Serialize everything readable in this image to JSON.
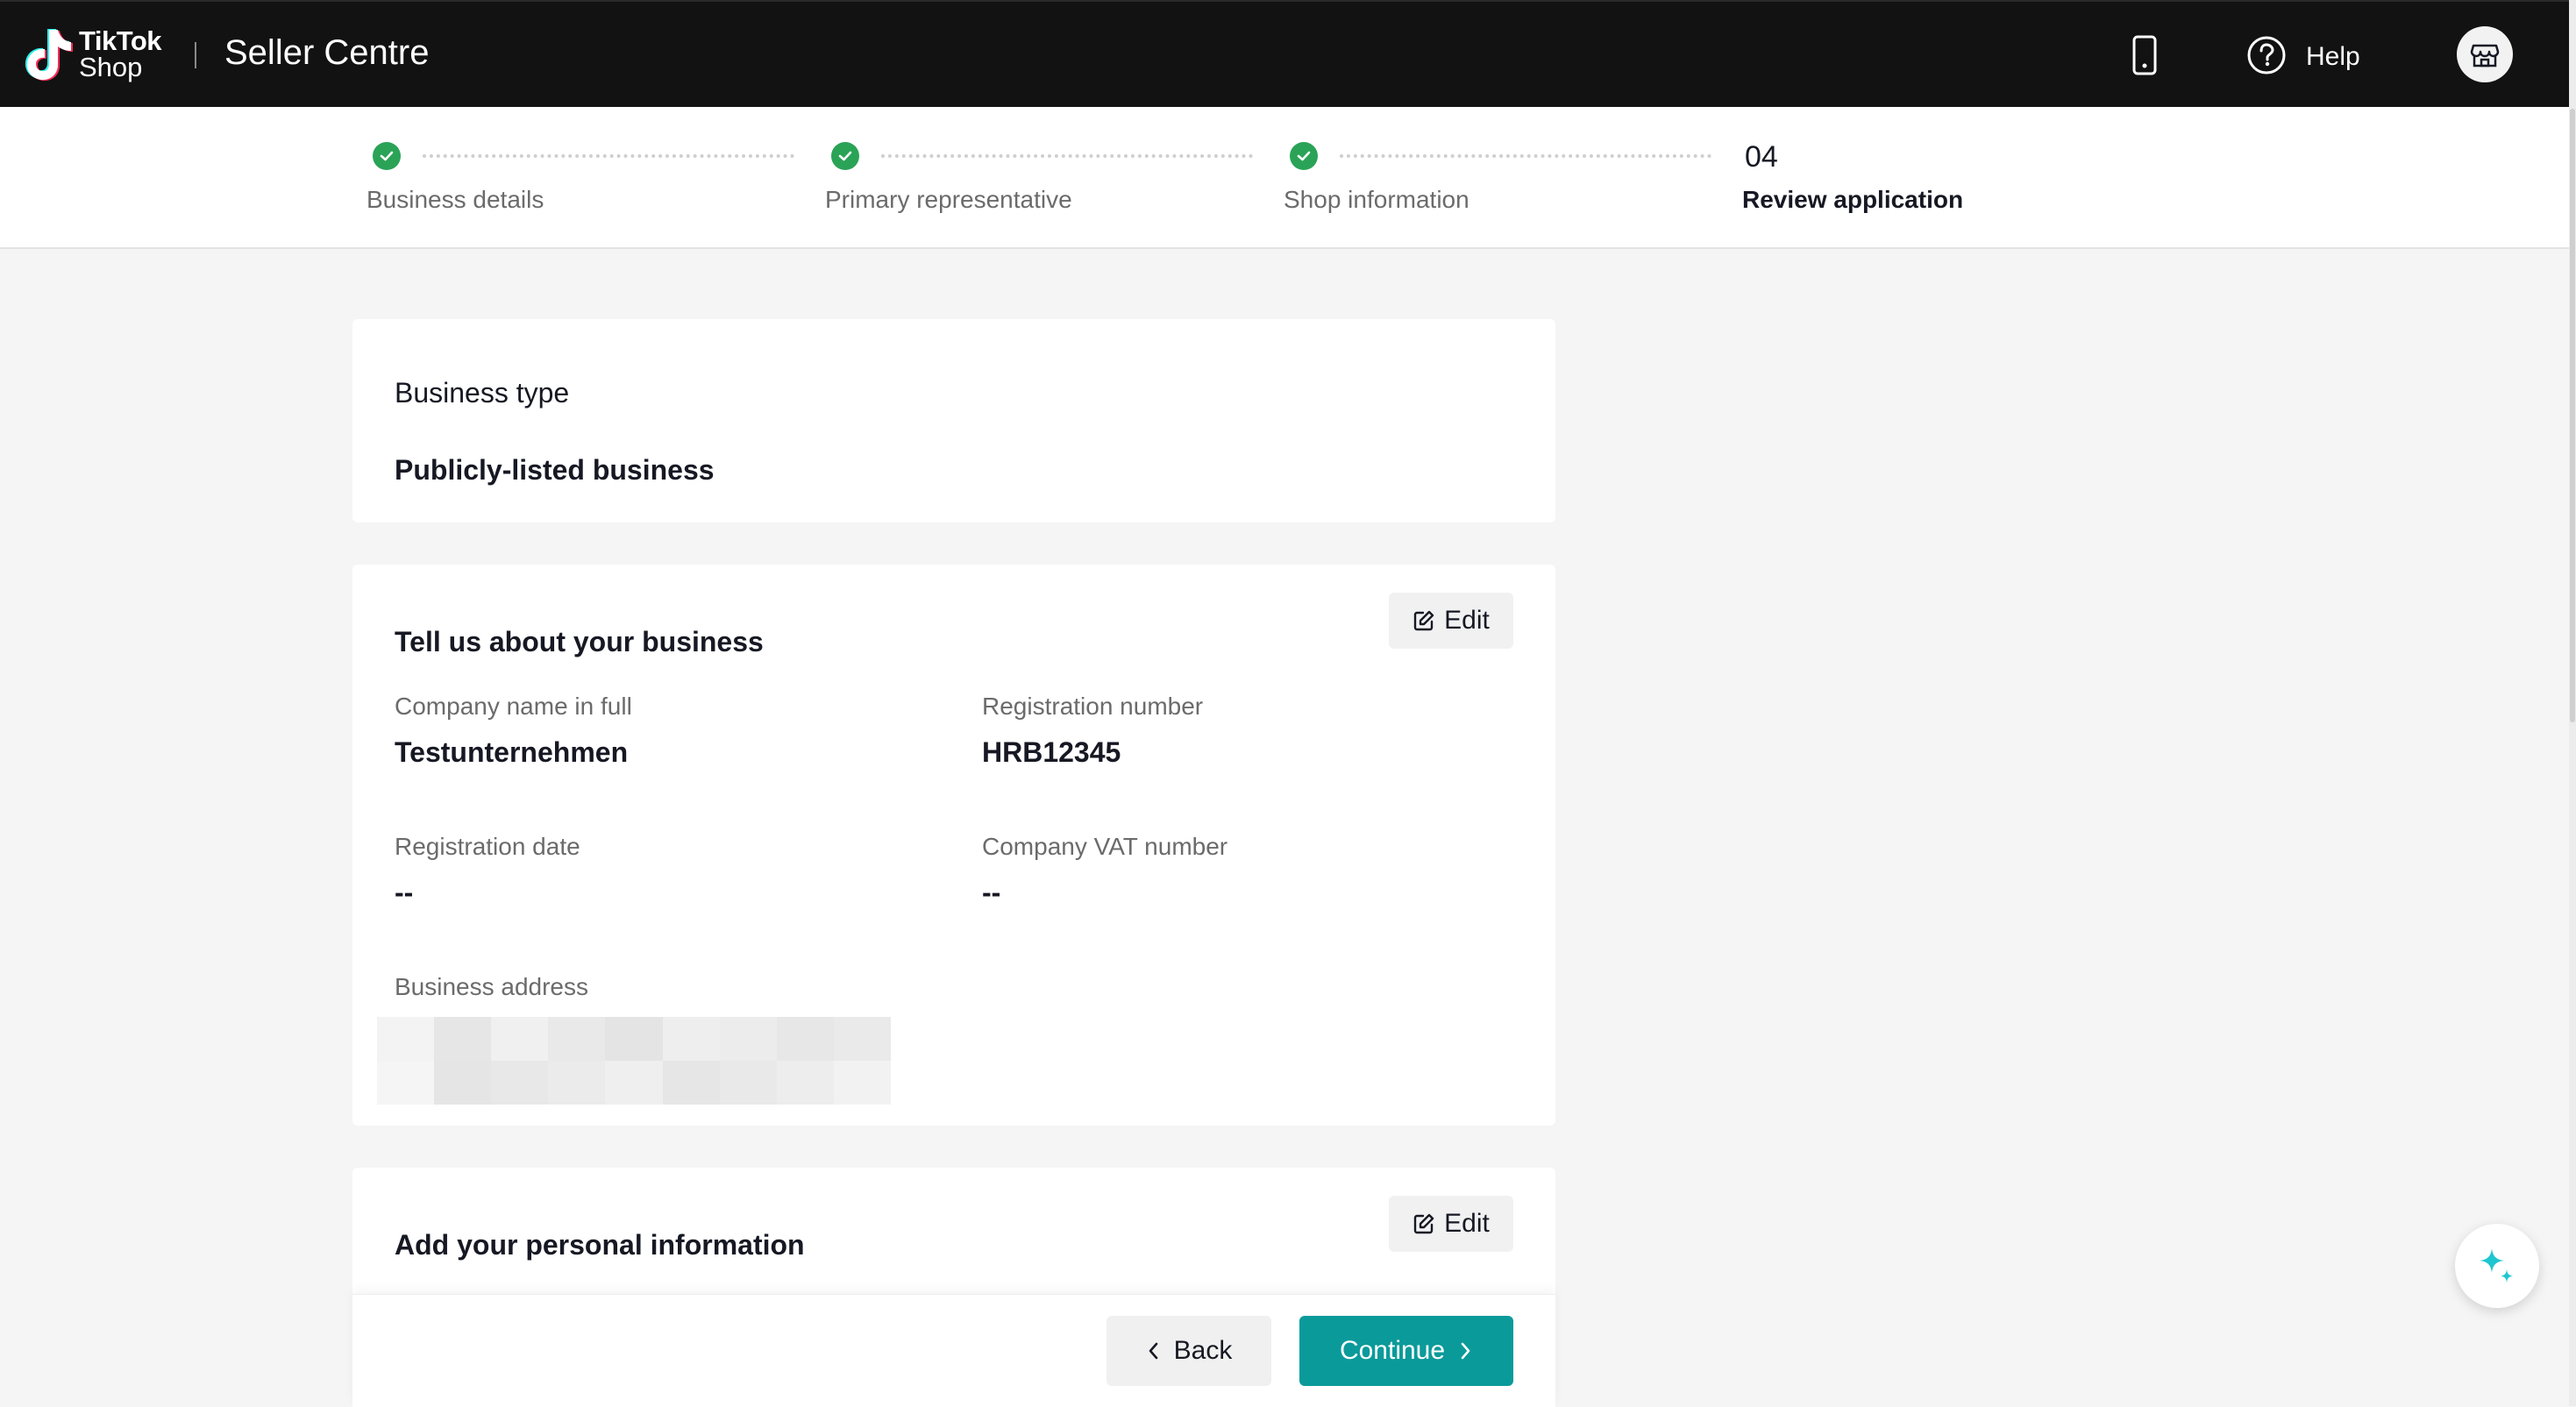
{
  "header": {
    "logo_line1": "TikTok",
    "logo_line2": "Shop",
    "app_title": "Seller Centre",
    "phone_icon": "mobile-phone-icon",
    "help_icon": "question-circle-icon",
    "help_label": "Help",
    "shop_icon": "store-icon"
  },
  "stepper": {
    "steps": [
      {
        "label": "Business details",
        "status": "completed"
      },
      {
        "label": "Primary representative",
        "status": "completed"
      },
      {
        "label": "Shop information",
        "status": "completed"
      },
      {
        "number": "04",
        "label": "Review application",
        "status": "current"
      }
    ],
    "completed_color": "#2aa357"
  },
  "business_type": {
    "title": "Business type",
    "value": "Publicly-listed business"
  },
  "business_info": {
    "title": "Tell us about your business",
    "edit_label": "Edit",
    "company_name_label": "Company name in full",
    "company_name_value": "Testunternehmen",
    "registration_number_label": "Registration number",
    "registration_number_value": "HRB12345",
    "registration_date_label": "Registration date",
    "registration_date_value": "--",
    "vat_label": "Company VAT number",
    "vat_value": "--",
    "address_label": "Business address"
  },
  "personal_info": {
    "title": "Add your personal information",
    "edit_label": "Edit"
  },
  "actions": {
    "back_label": "Back",
    "continue_label": "Continue",
    "primary_color": "#0b9a9a"
  },
  "assistant_icon": "sparkle-icon"
}
